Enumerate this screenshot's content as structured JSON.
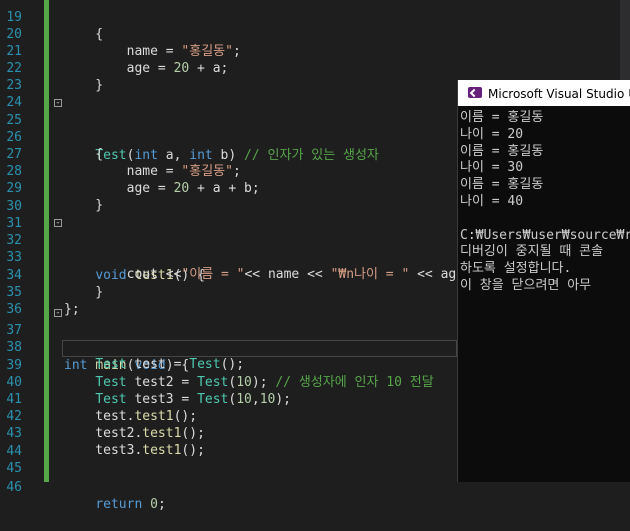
{
  "editor": {
    "lines": [
      {
        "n": "19",
        "t": "    {"
      },
      {
        "n": "20",
        "t": "        name = \"홍길동\";"
      },
      {
        "n": "21",
        "t": "        age = 20 + a;"
      },
      {
        "n": "22",
        "t": "    }"
      },
      {
        "n": "23",
        "t": ""
      },
      {
        "n": "24",
        "t": ""
      },
      {
        "n": "25",
        "t": "    Test(int a, int b) // 인자가 있는 생성자"
      },
      {
        "n": "26",
        "t": "    {"
      },
      {
        "n": "27",
        "t": "        name = \"홍길동\";"
      },
      {
        "n": "28",
        "t": "        age = 20 + a + b;"
      },
      {
        "n": "29",
        "t": "    }"
      },
      {
        "n": "30",
        "t": ""
      },
      {
        "n": "31",
        "t": ""
      },
      {
        "n": "32",
        "t": "    void test1() {"
      },
      {
        "n": "33",
        "t": "        cout <<\"이름 = \"<< name << \"₩n나이 = \" << age <<"
      },
      {
        "n": "34",
        "t": "    }"
      },
      {
        "n": "35",
        "t": "};"
      },
      {
        "n": "36",
        "t": ""
      },
      {
        "n": "37",
        "t": "int main(void) {"
      },
      {
        "n": "38",
        "t": "    Test test = Test();"
      },
      {
        "n": "39",
        "t": "    Test test2 = Test(10); // 생성자에 인자 10 전달"
      },
      {
        "n": "40",
        "t": "    Test test3 = Test(10,10);"
      },
      {
        "n": "41",
        "t": "    test.test1();"
      },
      {
        "n": "42",
        "t": "    test2.test1();"
      },
      {
        "n": "43",
        "t": "    test3.test1();"
      },
      {
        "n": "44",
        "t": ""
      },
      {
        "n": "45",
        "t": ""
      },
      {
        "n": "46",
        "t": "    return 0;"
      }
    ]
  },
  "console": {
    "title": "Microsoft Visual Studio 디",
    "output": [
      "이름 = 홍길동",
      "나이 = 20",
      "이름 = 홍길동",
      "나이 = 30",
      "이름 = 홍길동",
      "나이 = 40",
      "",
      "C:₩Users₩user₩source₩r",
      "디버깅이 중지될 때 콘솔",
      "하도록 설정합니다.",
      "이 창을 닫으려면 아무"
    ]
  }
}
